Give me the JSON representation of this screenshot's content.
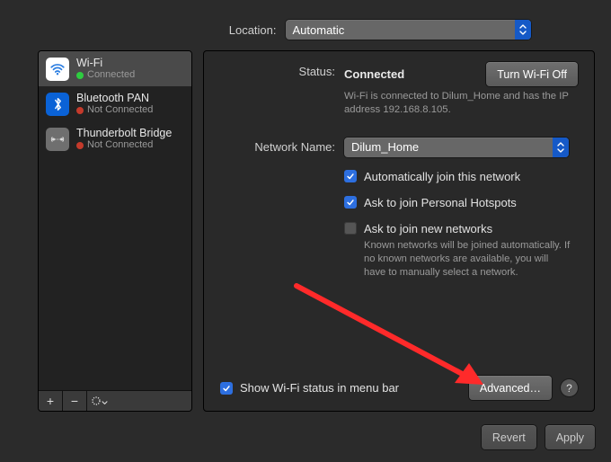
{
  "location": {
    "label": "Location:",
    "value": "Automatic"
  },
  "sidebar": {
    "items": [
      {
        "name": "Wi-Fi",
        "status": "Connected",
        "dot": "green",
        "selected": true,
        "icon": "wifi"
      },
      {
        "name": "Bluetooth PAN",
        "status": "Not Connected",
        "dot": "red",
        "selected": false,
        "icon": "bluetooth"
      },
      {
        "name": "Thunderbolt Bridge",
        "status": "Not Connected",
        "dot": "red",
        "selected": false,
        "icon": "thunderbolt"
      }
    ],
    "footer": {
      "add": "+",
      "remove": "−"
    }
  },
  "detail": {
    "status_label": "Status:",
    "status_value": "Connected",
    "wifi_toggle": "Turn Wi-Fi Off",
    "status_note": "Wi-Fi is connected to Dilum_Home and has the IP address 192.168.8.105.",
    "network_label": "Network Name:",
    "network_value": "Dilum_Home",
    "auto_join": "Automatically join this network",
    "ask_hotspots": "Ask to join Personal Hotspots",
    "ask_new": "Ask to join new networks",
    "ask_new_help": "Known networks will be joined automatically. If no known networks are available, you will have to manually select a network.",
    "show_status": "Show Wi-Fi status in menu bar",
    "advanced": "Advanced…",
    "help": "?"
  },
  "footer": {
    "revert": "Revert",
    "apply": "Apply"
  }
}
